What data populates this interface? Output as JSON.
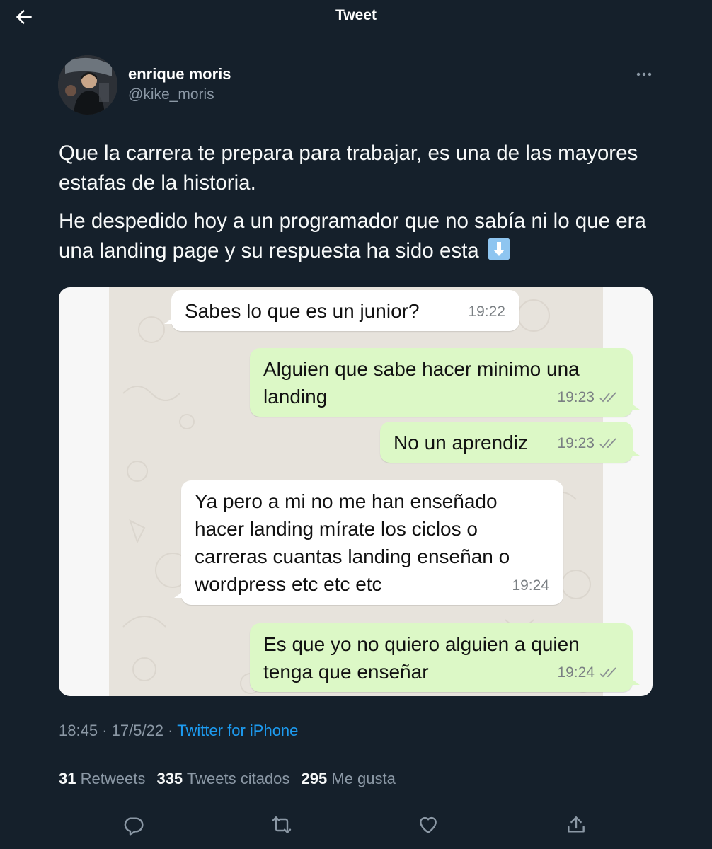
{
  "header": {
    "title": "Tweet",
    "back_icon": "arrow-left-icon"
  },
  "author": {
    "name": "enrique moris",
    "handle": "@kike_moris",
    "more_icon": "more-horizontal-icon"
  },
  "tweet": {
    "paragraph1": "Que la carrera te prepara para trabajar, es una de las mayores estafas de la historia.",
    "paragraph2": "He despedido hoy a un programador que no sabía ni lo que era una landing page y su respuesta ha sido esta",
    "emoji": "down-arrow-emoji"
  },
  "chat": {
    "messages": [
      {
        "direction": "incoming",
        "lines": [
          "Sabes lo que es un junior?"
        ],
        "time": "19:22"
      },
      {
        "direction": "outgoing",
        "lines": [
          "Alguien que sabe hacer minimo una",
          "landing"
        ],
        "time": "19:23"
      },
      {
        "direction": "outgoing",
        "lines": [
          "No un aprendiz"
        ],
        "time": "19:23"
      },
      {
        "direction": "incoming",
        "lines": [
          "Ya pero a mi no me han enseñado",
          "hacer landing mírate los ciclos o",
          "carreras cuantas landing enseñan o",
          "wordpress etc etc etc"
        ],
        "time": "19:24"
      },
      {
        "direction": "outgoing",
        "lines": [
          "Es que yo no quiero alguien a quien",
          "tenga que enseñar"
        ],
        "time": "19:24"
      }
    ]
  },
  "meta": {
    "time": "18:45",
    "separator": "·",
    "date": "17/5/22",
    "source": "Twitter for iPhone"
  },
  "stats": {
    "retweets_count": "31",
    "retweets_label": "Retweets",
    "quotes_count": "335",
    "quotes_label": "Tweets citados",
    "likes_count": "295",
    "likes_label": "Me gusta"
  },
  "actions": [
    "reply-icon",
    "retweet-icon",
    "like-icon",
    "share-icon"
  ],
  "colors": {
    "background": "#15202b",
    "secondary_text": "#8b98a5",
    "link": "#1d9bf0",
    "divider": "#38444d",
    "bubble_out": "#dcf8c6",
    "bubble_in": "#ffffff"
  }
}
